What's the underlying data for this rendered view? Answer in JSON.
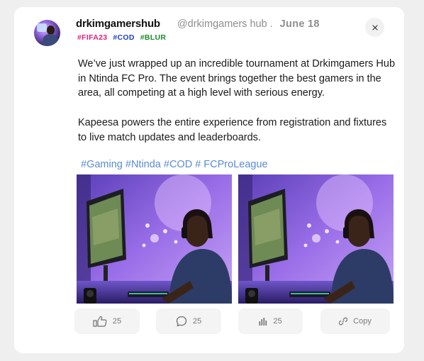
{
  "post": {
    "username": "drkimgamershub",
    "handle": "@drkimgamers hub",
    "separator": ".",
    "date": "June  18",
    "tags": [
      {
        "text": "#FIFA23",
        "color": "#e0217a"
      },
      {
        "text": "#COD",
        "color": "#1f3fbf"
      },
      {
        "text": "#BLUR",
        "color": "#1c8a2a"
      }
    ],
    "paragraph_1": "We’ve just wrapped up an incredible tournament at Drkimgamers Hub in Ntinda FC Pro. The event brings together the best gamers in the area, all competing at a high level with serious energy.",
    "paragraph_2": "Kapeesa powers the entire experience from registration and fixtures to live match updates and leaderboards.",
    "hashtags": [
      "#Gaming",
      "#Ntinda",
      "#COD",
      "# FCProLeague"
    ],
    "hashtag_color": "#5b8bd1"
  },
  "icons": {
    "close": "close-icon",
    "like": "thumbs-up-icon",
    "comment": "comment-bubble-icon",
    "stats": "bar-chart-icon",
    "copy": "link-icon"
  },
  "actions": {
    "likes": "25",
    "comments": "25",
    "views": "25",
    "copy_label": "Copy"
  }
}
